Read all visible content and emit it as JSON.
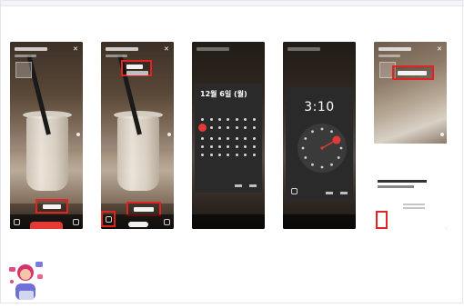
{
  "screens": [
    {
      "id": "step-1",
      "caption_visible": false
    },
    {
      "id": "step-2",
      "caption_visible": false
    },
    {
      "id": "step-3",
      "calendar": {
        "title": "12월 6일 (월)",
        "weekday_header": ""
      }
    },
    {
      "id": "step-4",
      "clock": {
        "time": "3:10"
      }
    },
    {
      "id": "step-5"
    }
  ],
  "colors": {
    "highlight": "#e52222",
    "accent": "#e53935",
    "background": "#ffffff"
  },
  "icons": {
    "close": "close-icon",
    "camera_switch": "camera-switch-icon",
    "gallery": "gallery-icon",
    "sticker": "sticker-icon"
  }
}
